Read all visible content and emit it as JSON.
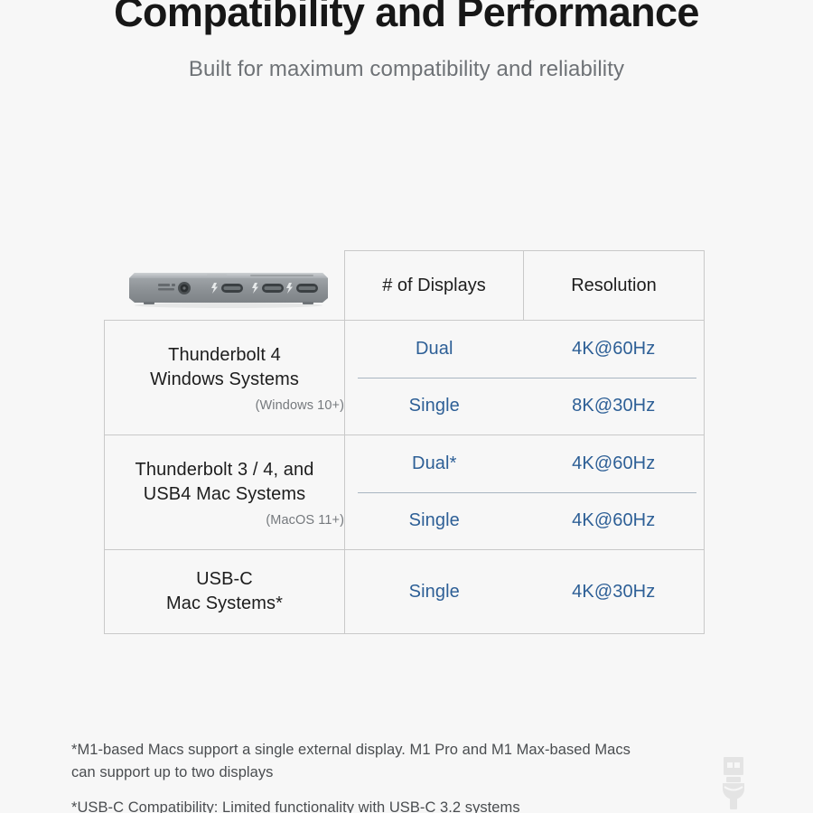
{
  "header": {
    "title": "Compatibility and Performance",
    "subtitle": "Built for maximum compatibility and reliability"
  },
  "product": {
    "alt": "thunderbolt-dock-device"
  },
  "table": {
    "columns": {
      "system": "",
      "displays": "# of Displays",
      "resolution": "Resolution"
    },
    "rows": [
      {
        "system_lines": [
          "Thunderbolt 4",
          "Windows Systems"
        ],
        "system_note": "(Windows 10+)",
        "entries": [
          {
            "displays": "Dual",
            "resolution": "4K@60Hz"
          },
          {
            "displays": "Single",
            "resolution": "8K@30Hz"
          }
        ]
      },
      {
        "system_lines": [
          "Thunderbolt 3 / 4, and",
          "USB4 Mac Systems"
        ],
        "system_note": "(MacOS 11+)",
        "entries": [
          {
            "displays": "Dual*",
            "resolution": "4K@60Hz"
          },
          {
            "displays": "Single",
            "resolution": "4K@60Hz"
          }
        ]
      },
      {
        "system_lines": [
          "USB-C",
          "Mac Systems*"
        ],
        "system_note": "",
        "entries": [
          {
            "displays": "Single",
            "resolution": "4K@30Hz"
          }
        ]
      }
    ]
  },
  "footnotes": [
    "*M1-based Macs support a single external display. M1 Pro and M1 Max-based Macs can support up to two displays",
    "*USB-C Compatibility: Limited functionality with USB-C 3.2 systems"
  ],
  "colors": {
    "background": "#f7f7f7",
    "title": "#171717",
    "subtitle": "#6e7276",
    "accent_blue": "#2d5f96",
    "border": "#c9c9c9",
    "sub_divider": "#a9b6c2",
    "note_text": "#4a4d50"
  },
  "watermark": {
    "icon": "usb-connector-icon"
  }
}
